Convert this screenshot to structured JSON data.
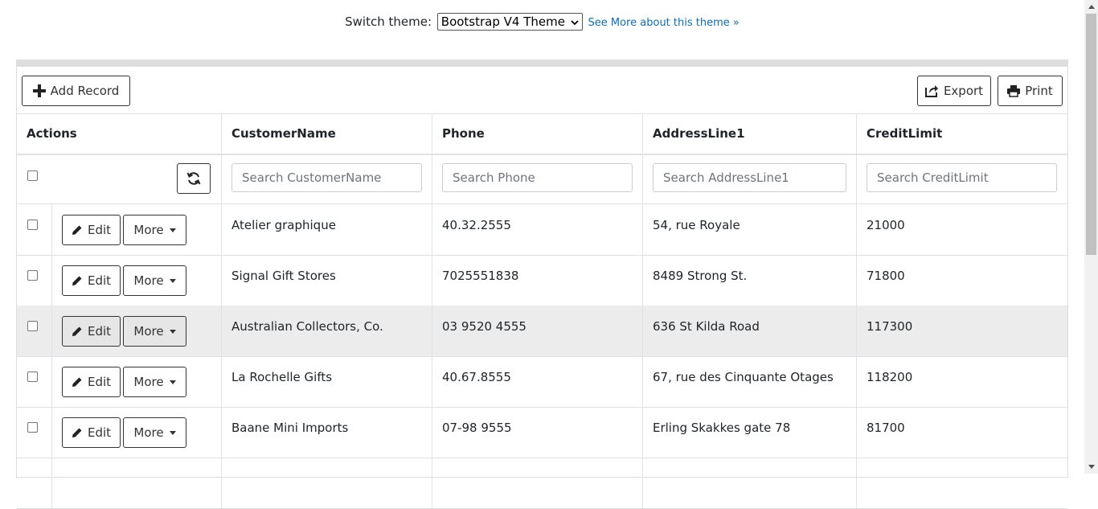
{
  "theme_switch": {
    "label": "Switch theme:",
    "selected": "Bootstrap V4 Theme",
    "link": "See More about this theme »"
  },
  "toolbar": {
    "add_label": "Add Record",
    "export_label": "Export",
    "print_label": "Print"
  },
  "columns": [
    "Actions",
    "CustomerName",
    "Phone",
    "AddressLine1",
    "CreditLimit"
  ],
  "search": {
    "customer": "Search CustomerName",
    "phone": "Search Phone",
    "address": "Search AddressLine1",
    "credit": "Search CreditLimit"
  },
  "row_buttons": {
    "edit": "Edit",
    "more": "More"
  },
  "rows": [
    {
      "name": "Atelier graphique",
      "phone": "40.32.2555",
      "address": "54, rue Royale",
      "credit": "21000"
    },
    {
      "name": "Signal Gift Stores",
      "phone": "7025551838",
      "address": "8489 Strong St.",
      "credit": "71800"
    },
    {
      "name": "Australian Collectors, Co.",
      "phone": "03 9520 4555",
      "address": "636 St Kilda Road",
      "credit": "117300"
    },
    {
      "name": "La Rochelle Gifts",
      "phone": "40.67.8555",
      "address": "67, rue des Cinquante Otages",
      "credit": "118200"
    },
    {
      "name": "Baane Mini Imports",
      "phone": "07-98 9555",
      "address": "Erling Skakkes gate 78",
      "credit": "81700"
    }
  ],
  "icons": {
    "add": "plus-icon",
    "export": "export-icon",
    "print": "print-icon",
    "refresh": "refresh-icon",
    "edit": "pencil-icon",
    "more": "caret-down-icon"
  },
  "colors": {
    "link": "#0a6ebd",
    "hover_row": "#ececec",
    "border": "#dee2e6"
  }
}
